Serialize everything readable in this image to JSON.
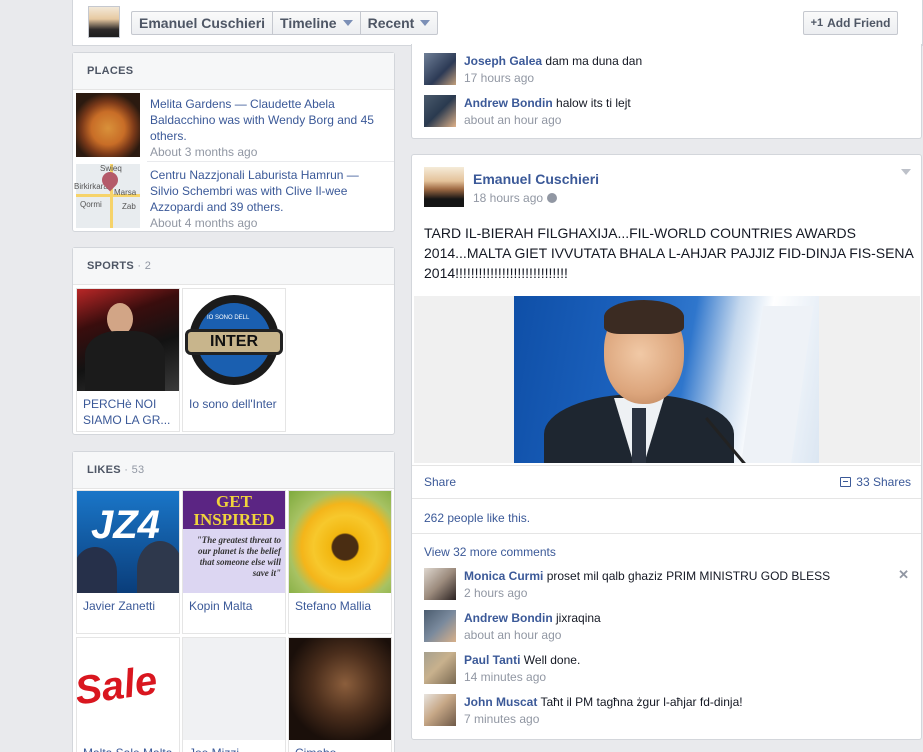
{
  "topbar": {
    "profile_name": "Emanuel Cuschieri",
    "timeline_label": "Timeline",
    "recent_label": "Recent",
    "add_friend_label": "Add Friend",
    "add_friend_icon": "+1"
  },
  "places": {
    "title": "PLACES",
    "items": [
      {
        "text": "Melita Gardens — Claudette Abela Baldacchino was with Wendy Borg and 45 others.",
        "time": "About 3 months ago"
      },
      {
        "text": "Centru Nazzjonali Laburista Hamrun — Silvio Schembri was with Clive Il-wee Azzopardi and 39 others.",
        "time": "About 4 months ago"
      }
    ],
    "map_labels": [
      "Swieq",
      "Birkirkara",
      "Marsa",
      "Qormi",
      "Zab"
    ]
  },
  "sports": {
    "title": "SPORTS",
    "count": "· 2",
    "items": [
      {
        "label": "PERCHè NOI SIAMO LA GR..."
      },
      {
        "label": "Io sono dell'Inter",
        "logo_text": "INTER",
        "logo_small": "IO SONO DELL"
      }
    ]
  },
  "likes": {
    "title": "LIKES",
    "count": "· 53",
    "items": [
      {
        "label": "Javier Zanetti",
        "art": "JZ4"
      },
      {
        "label": "Kopin Malta",
        "art_top": "GET INSPIRED",
        "art_quote": "\"The greatest threat to our planet is the belief that someone else will save it\""
      },
      {
        "label": "Stefano Mallia"
      },
      {
        "label": "Malta Sale Malta",
        "art": "Sale"
      },
      {
        "label": "Joe Mizzi"
      },
      {
        "label": "Cimabo..."
      }
    ]
  },
  "top_comments": [
    {
      "name": "Joseph Galea",
      "text": "dam ma duna dan",
      "time": "17 hours ago"
    },
    {
      "name": "Andrew Bondin",
      "text": "halow its ti lejt",
      "time": "about an hour ago"
    }
  ],
  "post": {
    "author": "Emanuel Cuschieri",
    "time": "18 hours ago",
    "text": "TARD IL-BIERAH FILGHAXIJA...FIL-WORLD COUNTRIES AWARDS 2014...MALTA GIET IVVUTATA BHALA L-AHJAR PAJJIZ FID-DINJA FIS-SENA 2014!!!!!!!!!!!!!!!!!!!!!!!!!!!!!",
    "share_label": "Share",
    "shares_label": "33 Shares",
    "likes_text": "262 people like this.",
    "more_comments": "View 32 more comments",
    "close_glyph": "✕",
    "comments": [
      {
        "name": "Monica Curmi",
        "text": "proset mil qalb ghaziz PRIM MINISTRU GOD BLESS",
        "time": "2 hours ago"
      },
      {
        "name": "Andrew Bondin",
        "text": "jixraqina",
        "time": "about an hour ago"
      },
      {
        "name": "Paul Tanti",
        "text": "Well done.",
        "time": "14 minutes ago"
      },
      {
        "name": "John Muscat",
        "text": "Taħt il PM tagħna żgur l-aħjar fd-dinja!",
        "time": "7 minutes ago"
      }
    ]
  }
}
